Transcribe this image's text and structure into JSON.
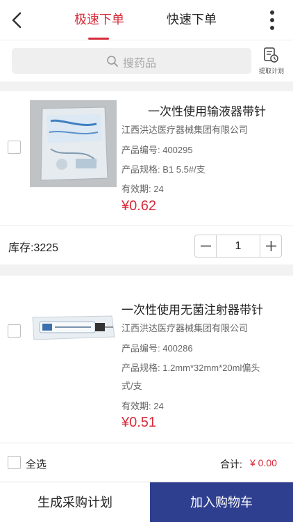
{
  "header": {
    "tabs": [
      {
        "label": "极速下单",
        "active": true
      },
      {
        "label": "快速下单",
        "active": false
      }
    ],
    "back_icon": "chevron-left-icon",
    "more_icon": "more-vertical-icon"
  },
  "search": {
    "placeholder": "搜药品",
    "plan_label": "提取计划"
  },
  "products": [
    {
      "name": "一次性使用输液器带针",
      "manufacturer": "江西洪达医疗器械集团有限公司",
      "code_line": "产品编号: 400295",
      "spec_line": "产品规格: B1   5.5#/支",
      "expiry_line": "有效期: 24",
      "price": "¥0.62",
      "stock": "库存:3225",
      "quantity": "1"
    },
    {
      "name": "一次性使用无菌注射器带针",
      "manufacturer": "江西洪达医疗器械集团有限公司",
      "code_line": "产品编号: 400286",
      "spec_line": "产品规格: 1.2mm*32mm*20ml偏头",
      "spec_line2": "式/支",
      "expiry_line": "有效期: 24",
      "price": "¥0.51"
    }
  ],
  "footer": {
    "select_all": "全选",
    "total_label": "合计:",
    "total_value": "¥ 0.00",
    "plan_button": "生成采购计划",
    "cart_button": "加入购物车"
  },
  "colors": {
    "accent": "#d92b3a",
    "cart_button_bg": "#2f3f8f"
  }
}
